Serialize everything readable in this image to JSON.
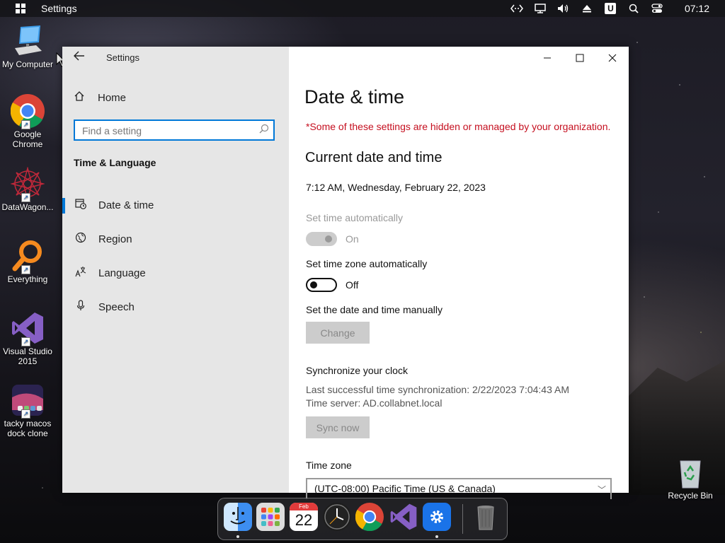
{
  "topbar": {
    "title": "Settings",
    "clock": "07:12",
    "tray_icons": [
      "remote-desktop-icon",
      "display-icon",
      "volume-icon",
      "eject-icon",
      "u-app-icon",
      "search-icon",
      "toggle-icon"
    ]
  },
  "desktop_icons": [
    {
      "label": "My Computer"
    },
    {
      "label": "Google Chrome"
    },
    {
      "label": "DataWagon..."
    },
    {
      "label": "Everything"
    },
    {
      "label": "Visual Studio 2015"
    },
    {
      "label": "tacky macos dock clone"
    },
    {
      "label": "Recycle Bin"
    }
  ],
  "window": {
    "app_title": "Settings",
    "home_label": "Home",
    "search_placeholder": "Find a setting",
    "section_title": "Time & Language",
    "nav": [
      {
        "label": "Date & time",
        "icon": "calendar-clock-icon",
        "active": true
      },
      {
        "label": "Region",
        "icon": "globe-icon",
        "active": false
      },
      {
        "label": "Language",
        "icon": "language-icon",
        "active": false
      },
      {
        "label": "Speech",
        "icon": "microphone-icon",
        "active": false
      }
    ],
    "page_title": "Date & time",
    "managed_warning": "*Some of these settings are hidden or managed by your organization.",
    "current_heading": "Current date and time",
    "current_datetime": "7:12 AM, Wednesday, February 22, 2023",
    "set_time_auto_label": "Set time automatically",
    "set_time_auto_state": "On",
    "set_tz_auto_label": "Set time zone automatically",
    "set_tz_auto_state": "Off",
    "manual_label": "Set the date and time manually",
    "change_button": "Change",
    "sync_heading": "Synchronize your clock",
    "last_sync": "Last successful time synchronization: 2/22/2023 7:04:43 AM",
    "time_server": "Time server: AD.collabnet.local",
    "sync_button": "Sync now",
    "timezone_label": "Time zone",
    "timezone_value": "(UTC-08:00) Pacific Time (US & Canada)"
  },
  "dock": {
    "calendar_month": "Feb",
    "calendar_day": "22",
    "apps": [
      "finder-icon",
      "launchpad-icon",
      "calendar-icon",
      "clock-icon",
      "chrome-icon",
      "visual-studio-icon",
      "settings-icon",
      "trash-icon"
    ]
  },
  "colors": {
    "accent": "#0078d7",
    "warning": "#c50f1f"
  }
}
